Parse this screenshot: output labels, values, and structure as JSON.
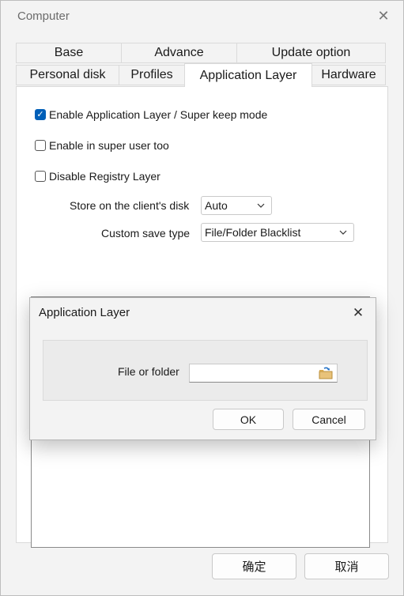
{
  "window": {
    "title": "Computer",
    "ok_label": "确定",
    "cancel_label": "取消"
  },
  "tabs": {
    "row1": [
      "Base",
      "Advance",
      "Update option"
    ],
    "row2": [
      "Personal disk",
      "Profiles",
      "Application Layer",
      "Hardware"
    ],
    "active": "Application Layer"
  },
  "panel": {
    "enable_app_layer": {
      "label": "Enable Application Layer / Super keep mode",
      "checked": true
    },
    "enable_super_user": {
      "label": "Enable in super user too",
      "checked": false
    },
    "disable_registry": {
      "label": "Disable Registry Layer",
      "checked": false
    },
    "store_label": "Store on the client's disk",
    "store_value": "Auto",
    "save_type_label": "Custom save type",
    "save_type_value": "File/Folder Blacklist"
  },
  "dialog": {
    "title": "Application Layer",
    "file_label": "File or folder",
    "file_value": "",
    "ok_label": "OK",
    "cancel_label": "Cancel"
  },
  "colors": {
    "accent": "#005fb8"
  }
}
